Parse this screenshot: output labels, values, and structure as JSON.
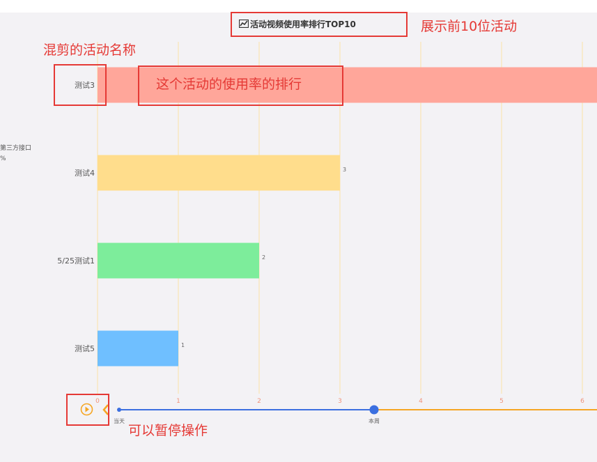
{
  "chart_data": {
    "type": "bar",
    "orientation": "horizontal",
    "title": "活动视频使用率排行TOP10",
    "categories": [
      "测试3",
      "测试4",
      "5/25测试1",
      "测试5"
    ],
    "values": [
      6.2,
      3,
      2,
      1
    ],
    "value_labels": [
      "",
      "3",
      "2",
      "1"
    ],
    "colors": [
      "#ffa69a",
      "#ffdd8c",
      "#7ded9b",
      "#6fbfff"
    ],
    "xticks": [
      "0",
      "1",
      "2",
      "3",
      "4",
      "5",
      "6"
    ],
    "xlim": [
      0,
      6.2
    ],
    "grid": "vertical",
    "grid_color": "#fbe3a6"
  },
  "title_icon": "trend-chart-icon",
  "side_notes": [
    "第三方接口",
    "%"
  ],
  "timeline": {
    "labels": [
      "当天",
      "本周"
    ],
    "current_index": 1,
    "progress_color": "#3b6fe0",
    "rest_color": "#f5a623",
    "controls": [
      "play-icon",
      "prev-arrow-icon"
    ]
  },
  "annotations": {
    "show_top10": "展示前10位活动",
    "mixed_name": "混剪的活动名称",
    "usage_rank": "这个活动的使用率的排行",
    "pausable": "可以暂停操作",
    "color": "#e53935"
  }
}
